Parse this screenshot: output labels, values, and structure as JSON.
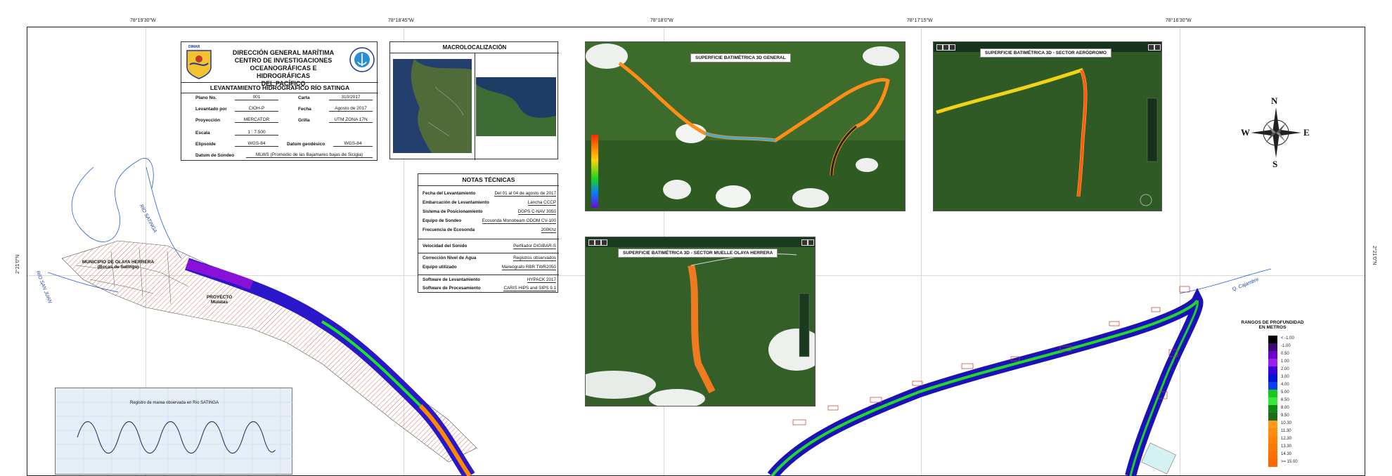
{
  "coords": {
    "top": [
      "78°19'30\"W",
      "78°18'45\"W",
      "78°18'0\"W",
      "78°17'15\"W",
      "78°16'30\"W"
    ],
    "left": "2°21'0\"N",
    "right": "2°21'0\"N"
  },
  "title_block": {
    "lines": [
      "DIRECCIÓN GENERAL MARÍTIMA",
      "CENTRO DE INVESTIGACIONES",
      "OCEANOGRÁFICAS E HIDROGRÁFICAS",
      "DEL PACÍFICO"
    ],
    "survey_title": "LEVANTAMIENTO HIDROGRÁFICO RÍO SATINGA",
    "logo_text": "DIMAR",
    "fields": {
      "plano_label": "Plano No.",
      "plano_value": "001",
      "carta_label": "Carta",
      "carta_value": "310/2017",
      "levantado_label": "Levantado por",
      "levantado_value": "CIOH-P",
      "fecha_label": "Fecha",
      "fecha_value": "Agosto de 2017",
      "proyeccion_label": "Proyección",
      "proyeccion_value": "MERCATOR",
      "grilla_label": "Grilla",
      "grilla_value": "UTM ZONA 17N",
      "escala_label": "Escala",
      "escala_value": "1 : 7.500",
      "elipsoide_label": "Elipsoide",
      "elipsoide_value": "WGS-84",
      "datum_geo_label": "Datum geodésico",
      "datum_geo_value": "WGS-84",
      "datum_sondeo_label": "Datum de Sondeo",
      "datum_sondeo_value": "MLWS (Promedio de las Bajamares bajas de Sicigia)"
    }
  },
  "macro": {
    "title": "MACROLOCALIZACIÓN"
  },
  "notes": {
    "title": "NOTAS TÉCNICAS",
    "rows": [
      {
        "label": "Fecha del Levantamiento",
        "value": "Del 01 al 04 de agosto de 2017"
      },
      {
        "label": "Embarcación de Levantamiento",
        "value": "Lancha CCCP"
      },
      {
        "label": "Sistema de Posicionamiento",
        "value": "DGPS C-NAV 3050"
      },
      {
        "label": "Equipo de Sondeo",
        "value": "Ecosonda Monobeam ODOM CV-100"
      },
      {
        "label": "Frecuencia de Ecosonda",
        "value": "200Khz"
      },
      {
        "label": "Velocidad del Sonido",
        "value": "Perfilador DIGIBAR-S"
      },
      {
        "label": "Corrección Nivel de Agua",
        "value": "Registros observados"
      },
      {
        "label": "Equipo utilizado",
        "value": "Mareógrafo RBR TWR2050"
      },
      {
        "label": "Software de Levantamiento",
        "value": "HYPACK 2017"
      },
      {
        "label": "Software de Procesamiento",
        "value": "CARIS HIPS and SIPS 9.1"
      }
    ]
  },
  "panels": {
    "general": "SUPERFICIE BATIMÉTRICA 3D GENERAL",
    "aerodromo": "SUPERFICIE BATIMÉTRICA 3D - SECTOR AERÓDROMO",
    "muelle": "SUPERFICIE BATIMÉTRICA 3D - SECTOR MUELLE OLAYA HERRERA"
  },
  "compass": {
    "n": "N",
    "s": "S",
    "e": "E",
    "w": "W"
  },
  "map_labels": {
    "municipio": "MUNICIPIO DE OLAYA HERRERA",
    "municipio_sub": "(Bocas de Satinga)",
    "proyecto": "PROYECTO",
    "proyecto_sub": "Mulatas",
    "rio_satinga": "RÍO SATINGA",
    "rio_sanjuan": "RÍO SAN JUAN",
    "q_cajambre": "Q. Cajambre"
  },
  "legend": {
    "title_line1": "RANGOS DE PROFUNDIDAD",
    "title_line2": "EN METROS",
    "items": [
      {
        "label": "< -1.00",
        "color": "#000000"
      },
      {
        "label": "-1.00",
        "color": "#3a0a6e"
      },
      {
        "label": "0.50",
        "color": "#6a00c8"
      },
      {
        "label": "1.00",
        "color": "#9b1fe8"
      },
      {
        "label": "2.00",
        "color": "#3a00d6"
      },
      {
        "label": "3.00",
        "color": "#0015d8"
      },
      {
        "label": "4.00",
        "color": "#0a3ef0"
      },
      {
        "label": "5.00",
        "color": "#19c81e"
      },
      {
        "label": "6.50",
        "color": "#39e639"
      },
      {
        "label": "8.00",
        "color": "#0e8a12"
      },
      {
        "label": "9.50",
        "color": "#1f6b14"
      },
      {
        "label": "10.30",
        "color": "#ff9a1a"
      },
      {
        "label": "11.30",
        "color": "#ff8c0a"
      },
      {
        "label": "12.30",
        "color": "#ff8200"
      },
      {
        "label": "13.30",
        "color": "#ff7a00"
      },
      {
        "label": "14.30",
        "color": "#ff7000"
      },
      {
        "label": ">= 15.00",
        "color": "#ff6600"
      }
    ]
  },
  "tide_chart": {
    "title": "Registro de marea observada en Río SATINGA"
  }
}
